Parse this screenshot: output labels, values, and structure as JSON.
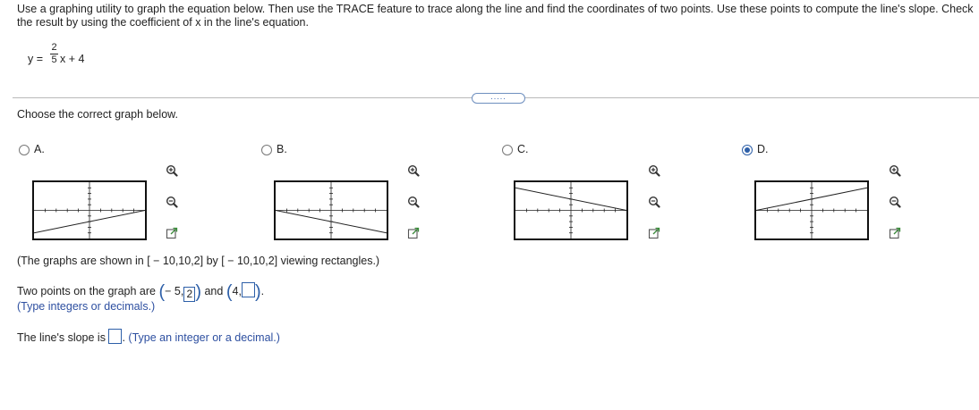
{
  "instructions": "Use a graphing utility to graph the equation below. Then use the TRACE feature to trace along the line and find the coordinates of two points. Use these points to compute the line's slope. Check the result by using the coefficient of x in the line's equation.",
  "equation": {
    "lhs": "y =",
    "numerator": "2",
    "denominator": "5",
    "rhs": "x + 4"
  },
  "more_button": ".....",
  "choose_prompt": "Choose the correct graph below.",
  "options": [
    {
      "letter": "A.",
      "selected": false
    },
    {
      "letter": "B.",
      "selected": false
    },
    {
      "letter": "C.",
      "selected": false
    },
    {
      "letter": "D.",
      "selected": true
    }
  ],
  "caption": "(The graphs are shown in [ − 10,10,2] by [ − 10,10,2] viewing rectangles.)",
  "points": {
    "label": "Two points on the graph are",
    "p1_x": "− 5,",
    "p1_y": "2",
    "and": "and",
    "p2_x": "4,",
    "p2_y": "",
    "end": "."
  },
  "points_hint": "(Type integers or decimals.)",
  "slope": {
    "label": "The line's slope is",
    "value": "",
    "end": ".",
    "hint": "(Type an integer or a decimal.)"
  },
  "colors": {
    "accent": "#2d5fa8",
    "hint_text": "#2d4fa0",
    "divider": "#b9b9b9"
  },
  "icons": [
    "zoom-in-icon",
    "zoom-out-icon",
    "external-link-icon"
  ]
}
